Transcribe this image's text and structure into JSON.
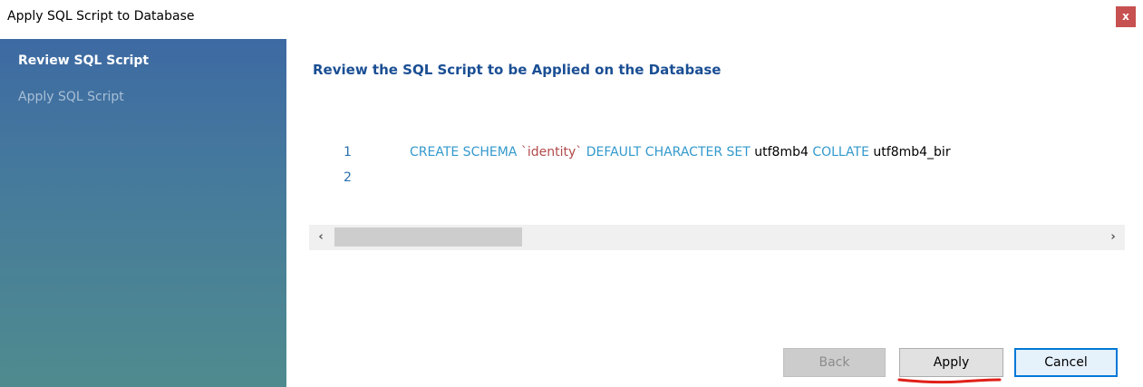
{
  "window": {
    "title": "Apply SQL Script to Database",
    "close_label": "x"
  },
  "sidebar": {
    "items": [
      {
        "label": "Review SQL Script",
        "active": true
      },
      {
        "label": "Apply SQL Script",
        "active": false
      }
    ]
  },
  "main": {
    "heading": "Review the SQL Script to be Applied on the Database",
    "editor": {
      "lines": [
        {
          "number": "1",
          "tokens": [
            {
              "text": "CREATE SCHEMA ",
              "kind": "keyword"
            },
            {
              "text": "`identity`",
              "kind": "string"
            },
            {
              "text": " DEFAULT CHARACTER SET ",
              "kind": "keyword"
            },
            {
              "text": "utf8mb4",
              "kind": "identifier"
            },
            {
              "text": " COLLATE ",
              "kind": "keyword"
            },
            {
              "text": "utf8mb4_bir",
              "kind": "identifier"
            }
          ]
        },
        {
          "number": "2",
          "tokens": []
        }
      ],
      "colors": {
        "keyword": "#3399cc",
        "string": "#b24a4a",
        "identifier": "#000000",
        "line_number": "#2a6fad"
      }
    },
    "scrollbar": {
      "left_arrow": "‹",
      "right_arrow": "›"
    }
  },
  "buttons": {
    "back": {
      "label": "Back",
      "enabled": false
    },
    "apply": {
      "label": "Apply",
      "enabled": true
    },
    "cancel": {
      "label": "Cancel",
      "enabled": true,
      "default": true
    }
  },
  "annotation": {
    "underline_target": "apply",
    "color": "#e0201a"
  },
  "colors": {
    "accent": "#0078d7",
    "heading": "#1b4f94",
    "close_button": "#c75050"
  }
}
